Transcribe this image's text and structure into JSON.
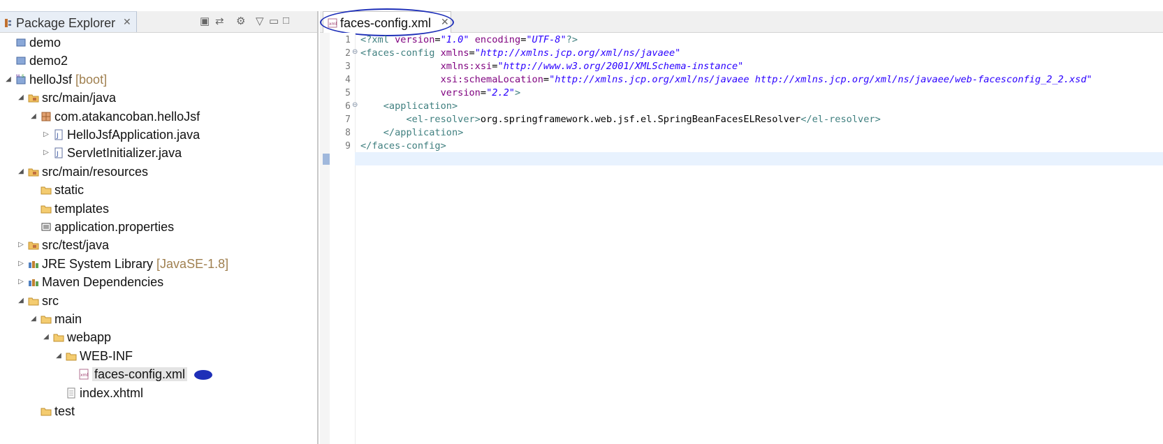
{
  "package_explorer": {
    "title": "Package Explorer",
    "close_glyph": "✕",
    "toolbar": [
      "collapse-all-icon",
      "link-with-editor-icon",
      "filter-icon",
      "view-menu-icon",
      "minimize-icon",
      "maximize-icon"
    ],
    "tree": [
      {
        "label": "demo",
        "decoration": "",
        "icon": "project-icon",
        "expanded": null,
        "depth": 0
      },
      {
        "label": "demo2",
        "decoration": "",
        "icon": "project-icon",
        "expanded": null,
        "depth": 0
      },
      {
        "label": "helloJsf",
        "decoration": "[boot]",
        "icon": "maven-spring-project-icon",
        "expanded": true,
        "depth": 0
      },
      {
        "label": "src/main/java",
        "decoration": "",
        "icon": "source-folder-icon",
        "expanded": true,
        "depth": 1
      },
      {
        "label": "com.atakancoban.helloJsf",
        "decoration": "",
        "icon": "package-icon",
        "expanded": true,
        "depth": 2
      },
      {
        "label": "HelloJsfApplication.java",
        "decoration": "",
        "icon": "java-file-icon",
        "expanded": false,
        "depth": 3
      },
      {
        "label": "ServletInitializer.java",
        "decoration": "",
        "icon": "java-file-icon",
        "expanded": false,
        "depth": 3
      },
      {
        "label": "src/main/resources",
        "decoration": "",
        "icon": "source-folder-icon",
        "expanded": true,
        "depth": 1
      },
      {
        "label": "static",
        "decoration": "",
        "icon": "folder-icon",
        "expanded": null,
        "depth": 2
      },
      {
        "label": "templates",
        "decoration": "",
        "icon": "folder-icon",
        "expanded": null,
        "depth": 2
      },
      {
        "label": "application.properties",
        "decoration": "",
        "icon": "properties-file-icon",
        "expanded": null,
        "depth": 2
      },
      {
        "label": "src/test/java",
        "decoration": "",
        "icon": "source-folder-icon",
        "expanded": false,
        "depth": 1
      },
      {
        "label": "JRE System Library",
        "decoration": "[JavaSE-1.8]",
        "icon": "library-icon",
        "expanded": false,
        "depth": 1
      },
      {
        "label": "Maven Dependencies",
        "decoration": "",
        "icon": "library-icon",
        "expanded": false,
        "depth": 1
      },
      {
        "label": "src",
        "decoration": "",
        "icon": "folder-icon",
        "expanded": true,
        "depth": 1
      },
      {
        "label": "main",
        "decoration": "",
        "icon": "folder-icon",
        "expanded": true,
        "depth": 2
      },
      {
        "label": "webapp",
        "decoration": "",
        "icon": "folder-icon",
        "expanded": true,
        "depth": 3
      },
      {
        "label": "WEB-INF",
        "decoration": "",
        "icon": "folder-icon",
        "expanded": true,
        "depth": 4
      },
      {
        "label": "faces-config.xml",
        "decoration": "",
        "icon": "xml-file-icon",
        "expanded": null,
        "depth": 5,
        "selected": true
      },
      {
        "label": "index.xhtml",
        "decoration": "",
        "icon": "file-icon",
        "expanded": null,
        "depth": 4
      },
      {
        "label": "test",
        "decoration": "",
        "icon": "folder-icon",
        "expanded": null,
        "depth": 2
      }
    ]
  },
  "editor": {
    "tab_label": "faces-config.xml",
    "close_glyph": "✕",
    "line_numbers": [
      "1",
      "2",
      "3",
      "4",
      "5",
      "6",
      "7",
      "8",
      "9"
    ],
    "lines": [
      [
        {
          "t": "tag",
          "s": "<?xml "
        },
        {
          "t": "att",
          "s": "version"
        },
        {
          "t": "txt",
          "s": "="
        },
        {
          "t": "val",
          "s": "\"1.0\""
        },
        {
          "t": "txt",
          "s": " "
        },
        {
          "t": "att",
          "s": "encoding"
        },
        {
          "t": "txt",
          "s": "="
        },
        {
          "t": "val",
          "s": "\"UTF-8\""
        },
        {
          "t": "tag",
          "s": "?>"
        }
      ],
      [
        {
          "t": "tag",
          "s": "<faces-config "
        },
        {
          "t": "att",
          "s": "xmlns"
        },
        {
          "t": "txt",
          "s": "="
        },
        {
          "t": "val",
          "s": "\"http://xmlns.jcp.org/xml/ns/javaee\""
        }
      ],
      [
        {
          "t": "txt",
          "s": "              "
        },
        {
          "t": "att",
          "s": "xmlns:xsi"
        },
        {
          "t": "txt",
          "s": "="
        },
        {
          "t": "val",
          "s": "\"http://www.w3.org/2001/XMLSchema-instance\""
        }
      ],
      [
        {
          "t": "txt",
          "s": "              "
        },
        {
          "t": "att",
          "s": "xsi:schemaLocation"
        },
        {
          "t": "txt",
          "s": "="
        },
        {
          "t": "val",
          "s": "\"http://xmlns.jcp.org/xml/ns/javaee http://xmlns.jcp.org/xml/ns/javaee/web-facesconfig_2_2.xsd\""
        }
      ],
      [
        {
          "t": "txt",
          "s": "              "
        },
        {
          "t": "att",
          "s": "version"
        },
        {
          "t": "txt",
          "s": "="
        },
        {
          "t": "val",
          "s": "\"2.2\""
        },
        {
          "t": "tag",
          "s": ">"
        }
      ],
      [
        {
          "t": "txt",
          "s": "    "
        },
        {
          "t": "tag",
          "s": "<application>"
        }
      ],
      [
        {
          "t": "txt",
          "s": "        "
        },
        {
          "t": "tag",
          "s": "<el-resolver>"
        },
        {
          "t": "txt",
          "s": "org.springframework.web.jsf.el.SpringBeanFacesELResolver"
        },
        {
          "t": "tag",
          "s": "</el-resolver>"
        }
      ],
      [
        {
          "t": "txt",
          "s": "    "
        },
        {
          "t": "tag",
          "s": "</application>"
        }
      ],
      [
        {
          "t": "tag",
          "s": "</faces-config>"
        }
      ]
    ],
    "fold_lines": [
      2,
      6
    ]
  },
  "colors": {
    "tag": "#3f7f7f",
    "attribute": "#7f007f",
    "value": "#2a00ff",
    "annotation_ink": "#1e2fb8"
  }
}
